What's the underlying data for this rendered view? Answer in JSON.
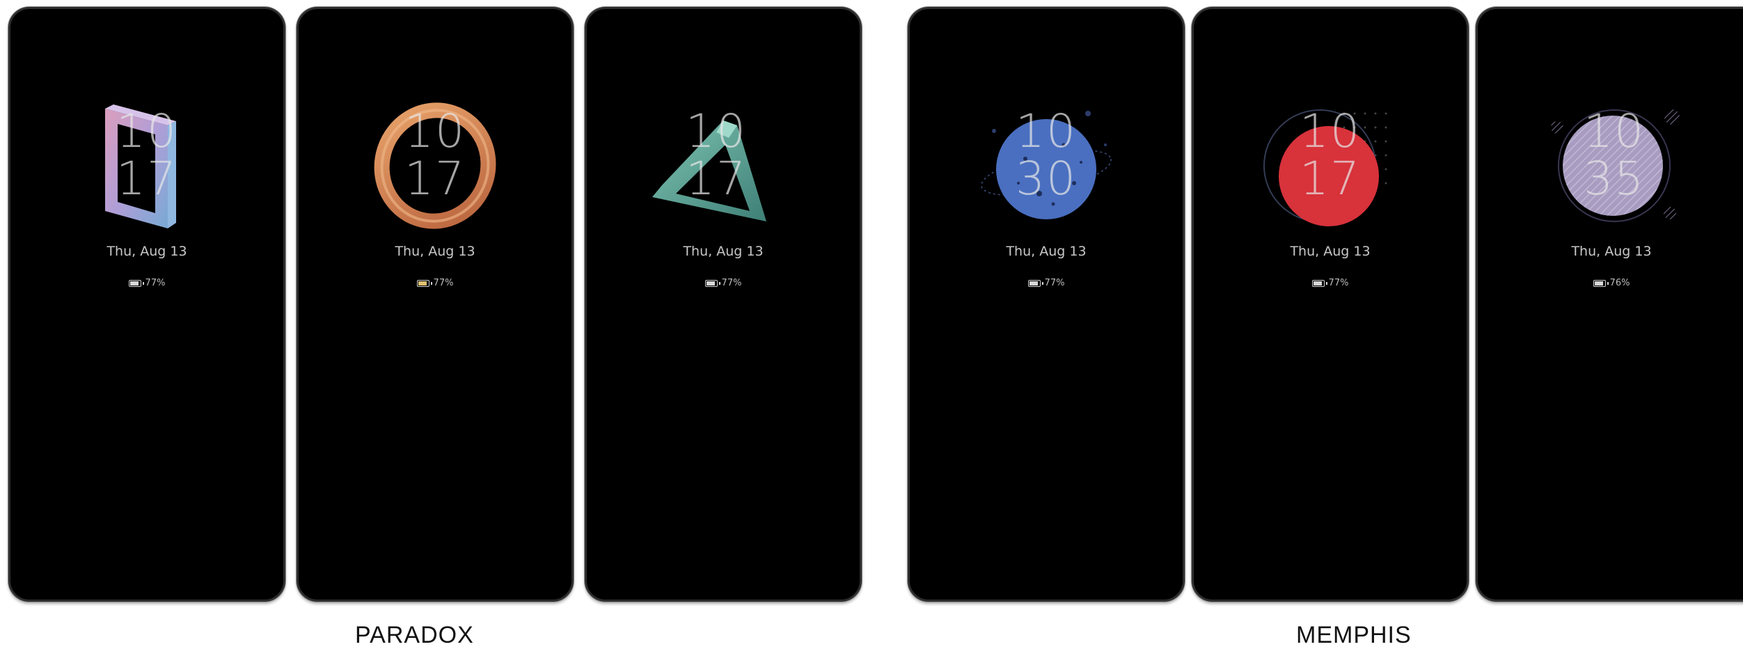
{
  "screens": [
    {
      "theme": "paradox",
      "shape": "square",
      "hour": "10",
      "minute": "17",
      "date": "Thu, Aug 13",
      "battery": "77%",
      "battery_level": 0.77,
      "accent": "#9fb4dc"
    },
    {
      "theme": "paradox",
      "shape": "ring",
      "hour": "10",
      "minute": "17",
      "date": "Thu, Aug 13",
      "battery": "77%",
      "battery_level": 0.77,
      "accent": "#d08a55"
    },
    {
      "theme": "paradox",
      "shape": "triangle",
      "hour": "10",
      "minute": "17",
      "date": "Thu, Aug 13",
      "battery": "77%",
      "battery_level": 0.77,
      "accent": "#5fa89a"
    },
    {
      "theme": "memphis",
      "shape": "blue-planet",
      "hour": "10",
      "minute": "30",
      "date": "Thu, Aug 13",
      "battery": "77%",
      "battery_level": 0.77,
      "accent": "#4a6fc0"
    },
    {
      "theme": "memphis",
      "shape": "red-sun",
      "hour": "10",
      "minute": "17",
      "date": "Thu, Aug 13",
      "battery": "77%",
      "battery_level": 0.77,
      "accent": "#d8323b"
    },
    {
      "theme": "memphis",
      "shape": "lilac-disc",
      "hour": "10",
      "minute": "35",
      "date": "Thu, Aug 13",
      "battery": "76%",
      "battery_level": 0.76,
      "accent": "#a89cc0"
    }
  ],
  "captions": {
    "paradox": "PARADOX",
    "memphis": "MEMPHIS"
  }
}
